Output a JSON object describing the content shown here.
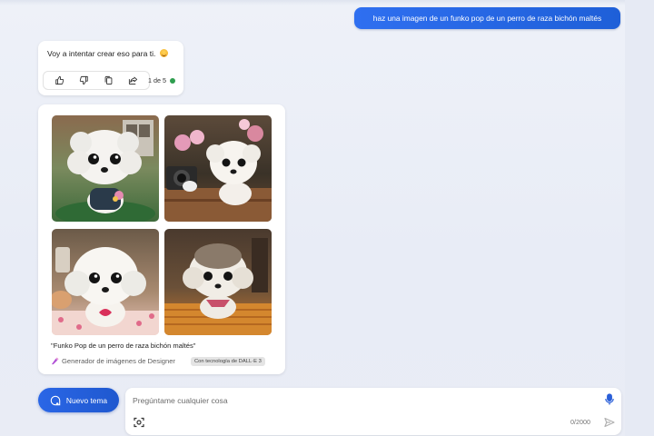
{
  "user_message": {
    "text": "haz una imagen de un funko pop de un perro de raza bichón maltés"
  },
  "bot_reply": {
    "text": "Voy a intentar crear eso para ti.",
    "emoji": "smiling-face-icon",
    "actions": [
      {
        "name": "like",
        "icon": "thumbs-up-icon"
      },
      {
        "name": "dislike",
        "icon": "thumbs-down-icon"
      },
      {
        "name": "copy",
        "icon": "copy-icon"
      },
      {
        "name": "share",
        "icon": "share-icon"
      }
    ],
    "page_count": "1 de 5",
    "status_color": "#2f9e4f"
  },
  "image_result": {
    "images": [
      "Funko pop white maltese dog, garden scene, holding flowers",
      "Funko pop maltese dog sitting on wooden table next to vintage camera, pink flowers",
      "Funko pop maltese dog with pink heart, sitting near cupcake and coffee",
      "Funko pop maltese dog with bandana, sitting on woven textile"
    ],
    "caption": "\"Funko Pop de un perro de raza bichón maltés\"",
    "designer_label": "Generador de imágenes de Designer",
    "badge": "Con tecnología de DALL·E 3"
  },
  "new_topic": {
    "label": "Nuevo tema"
  },
  "composer": {
    "placeholder": "Pregúntame cualquier cosa",
    "char_count": "0/2000"
  },
  "colors": {
    "accent": "#2563eb",
    "background": "#eef1f8"
  }
}
